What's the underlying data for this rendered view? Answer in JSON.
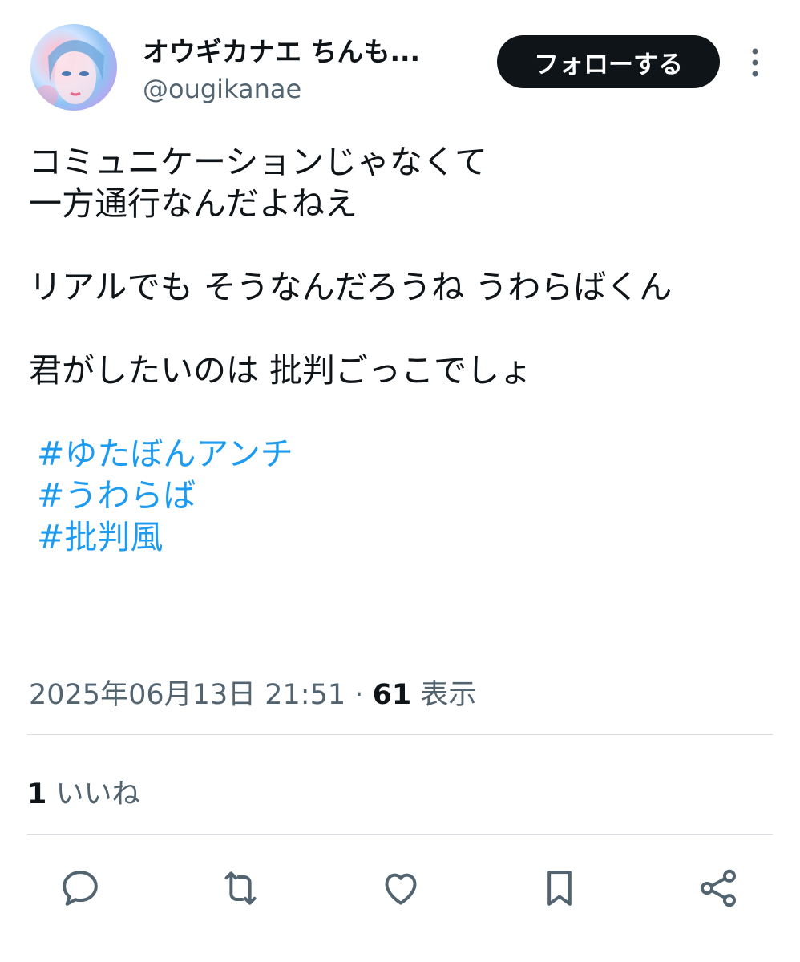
{
  "author": {
    "display_name": "オウギカナエ ちんも...",
    "handle": "@ougikanae",
    "avatar_icon": "avatar-illustration"
  },
  "follow_button": {
    "label": "フォローする"
  },
  "more_button": {
    "icon": "more-vertical-icon"
  },
  "tweet": {
    "lines": [
      "コミュニケーションじゃなくて",
      "一方通行なんだよねえ",
      "リアルでも そうなんだろうね うわらばくん",
      "君がしたいのは 批判ごっこでしょ"
    ],
    "hashtags": [
      "#ゆたぼんアンチ",
      "#うわらば",
      "#批判風"
    ]
  },
  "meta": {
    "timestamp": "2025年06月13日 21:51",
    "separator": "·",
    "views_count": "61",
    "views_label": "表示"
  },
  "engagement": {
    "likes_count": "1",
    "likes_label": "いいね"
  },
  "actions": [
    "reply-icon",
    "retweet-icon",
    "like-icon",
    "bookmark-icon",
    "share-icon"
  ],
  "colors": {
    "link": "#1d9bf0",
    "text": "#0f1419",
    "secondary": "#536471",
    "button": "#0f1419"
  }
}
